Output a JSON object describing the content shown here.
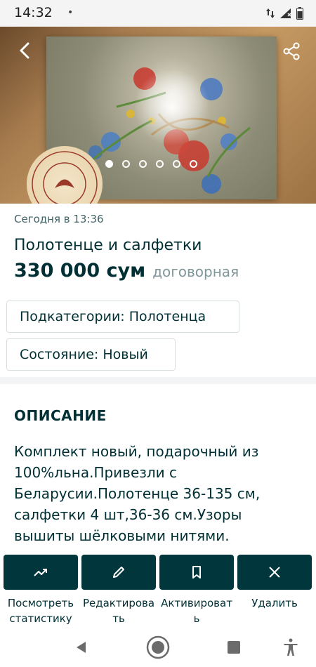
{
  "status_bar": {
    "time": "14:32",
    "indicator": "•",
    "icons": [
      "data-arrows-icon",
      "signal-icon",
      "battery-icon"
    ]
  },
  "gallery": {
    "image_count": 6,
    "active_index": 0,
    "icons": [
      "back-arrow-icon",
      "share-icon"
    ]
  },
  "listing": {
    "date": "Сегодня в 13:36",
    "title": "Полотенце и салфетки",
    "price": "330 000 сум",
    "negotiable": "договорная",
    "tags": [
      {
        "label": "Подкатегории: Полотенца"
      },
      {
        "label": "Состояние: Новый"
      }
    ]
  },
  "description": {
    "heading": "ОПИСАНИЕ",
    "text": "Комплект новый, подарочный из 100%льна.Привезли с Беларусии.Полотенце 36-135 см, салфетки 4 шт,36-36 см.Узоры вышиты шёлковыми нитями."
  },
  "actions": [
    {
      "label_line1": "Посмотреть",
      "label_line2": "статистику",
      "icon": "trend-up-icon"
    },
    {
      "label_line1": "Редактирова",
      "label_line2": "ть",
      "icon": "pencil-icon"
    },
    {
      "label_line1": "Активироват",
      "label_line2": "ь",
      "icon": "bookmark-icon"
    },
    {
      "label_line1": "Удалить",
      "label_line2": "",
      "icon": "close-icon"
    }
  ],
  "nav_bar": {
    "icons": [
      "back-triangle-icon",
      "home-circle-icon",
      "recents-square-icon",
      "accessibility-icon"
    ]
  },
  "colors": {
    "primary": "#002f34",
    "button_bg": "#02363d",
    "muted": "#7f9799"
  }
}
